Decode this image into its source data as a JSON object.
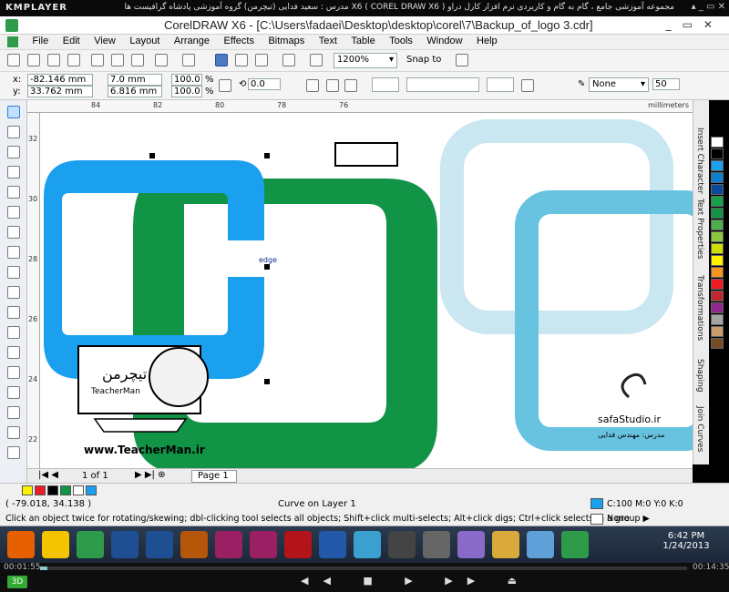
{
  "player": {
    "logo": "KMPLAYER",
    "title": "مجموعه آموزشی جامع ، گام به گام و کاربردی نرم افزار کارل دراو X6 ( COREL DRAW X6 ) مدرس : سعید فدایی (تیچرمن) گروه آموزشی پادشاه گرافیست ها",
    "elapsed": "00:01:55",
    "total": "00:14:35"
  },
  "window": {
    "title": "CorelDRAW X6 - [C:\\Users\\fadaei\\Desktop\\desktop\\corel\\7\\Backup_of_logo 3.cdr]"
  },
  "menus": [
    "File",
    "Edit",
    "View",
    "Layout",
    "Arrange",
    "Effects",
    "Bitmaps",
    "Text",
    "Table",
    "Tools",
    "Window",
    "Help"
  ],
  "toolbar": {
    "zoom": "1200%",
    "snap_to": "Snap to"
  },
  "props": {
    "x_label": "x:",
    "y_label": "y:",
    "x_value": "-82.146 mm",
    "y_value": "33.762 mm",
    "w_value": "7.0 mm",
    "h_value": "6.816 mm",
    "scale_x": "100.0",
    "scale_y": "100.0",
    "percent": "%",
    "angle": "0.0",
    "outline": "None",
    "outline_size": "50"
  },
  "ruler": {
    "units": "millimeters",
    "h_ticks": [
      "84",
      "82",
      "80",
      "78",
      "76"
    ],
    "v_ticks": [
      "32",
      "30",
      "28",
      "26",
      "24",
      "22"
    ]
  },
  "canvas": {
    "node_label": "edge",
    "watermark_url": "www.TeacherMan.ir",
    "badge_title": "تیچرمن",
    "badge_subtitle": "TeacherMan",
    "studio_name": "safaStudio.ir",
    "studio_sub": "مدرس: مهندس فدایی"
  },
  "docker_tabs": [
    "Insert Character",
    "Text Properties",
    "Transformations",
    "Shaping",
    "Join Curves"
  ],
  "palette": [
    "#ffffff",
    "#000000",
    "#1ba0ef",
    "#0b7fd0",
    "#0a4a9c",
    "#16a04a",
    "#119343",
    "#4cae4c",
    "#8dc63f",
    "#cfe000",
    "#fff200",
    "#f7941d",
    "#ed1c24",
    "#c1272d",
    "#92278f",
    "#a3a3a3",
    "#c69c6d",
    "#754c24"
  ],
  "docnav": {
    "page_count": "1 of 1",
    "page_tab": "Page 1"
  },
  "status": {
    "coords": "( -79.018, 34.138 )",
    "curve_on": "Curve on Layer 1",
    "hint": "Click an object twice for rotating/skewing; dbl-clicking tool selects all objects; Shift+click multi-selects; Alt+click digs; Ctrl+click selects in a group ▶",
    "fill": "C:100 M:0 Y:0 K:0",
    "outline": "None"
  },
  "taskbar": {
    "apps": [
      "firefox",
      "star",
      "corel",
      "Ps",
      "Ps",
      "Ai",
      "Id",
      "Id",
      "Fl",
      "P",
      "sync",
      "cd",
      "A",
      "dvd",
      "folder",
      "box",
      "corel"
    ],
    "time": "6:42 PM",
    "date": "1/24/2013"
  },
  "colors": {
    "blue_shape": "#1ba0ef",
    "green_shape": "#129447",
    "pixel_light": "#bfe3ee",
    "pixel_dark": "#4cb8da"
  }
}
